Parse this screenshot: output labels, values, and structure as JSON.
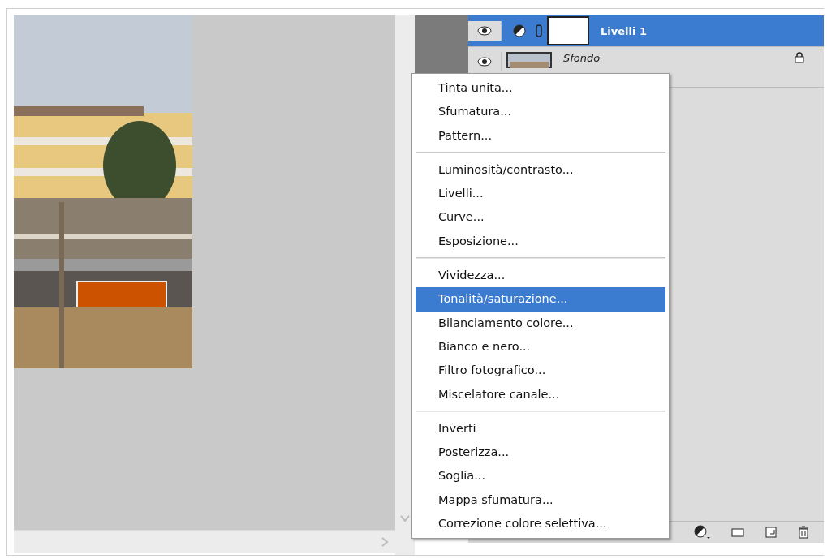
{
  "layers": [
    {
      "name": "Livelli 1",
      "kind": "adjustment",
      "selected": true,
      "visible": true,
      "locked": false
    },
    {
      "name": "Sfondo",
      "selected": false,
      "visible": true,
      "locked": true
    }
  ],
  "menu": {
    "groups": [
      [
        {
          "label": "Tinta unita...",
          "selected": false
        },
        {
          "label": "Sfumatura...",
          "selected": false
        },
        {
          "label": "Pattern...",
          "selected": false
        }
      ],
      [
        {
          "label": "Luminosità/contrasto...",
          "selected": false
        },
        {
          "label": "Livelli...",
          "selected": false
        },
        {
          "label": "Curve...",
          "selected": false
        },
        {
          "label": "Esposizione...",
          "selected": false
        }
      ],
      [
        {
          "label": "Vividezza...",
          "selected": false
        },
        {
          "label": "Tonalità/saturazione...",
          "selected": true
        },
        {
          "label": "Bilanciamento colore...",
          "selected": false
        },
        {
          "label": "Bianco e nero...",
          "selected": false
        },
        {
          "label": "Filtro fotografico...",
          "selected": false
        },
        {
          "label": "Miscelatore canale...",
          "selected": false
        }
      ],
      [
        {
          "label": "Inverti",
          "selected": false
        },
        {
          "label": "Posterizza...",
          "selected": false
        },
        {
          "label": "Soglia...",
          "selected": false
        },
        {
          "label": "Mappa sfumatura...",
          "selected": false
        },
        {
          "label": "Correzione colore selettiva...",
          "selected": false
        }
      ]
    ]
  }
}
